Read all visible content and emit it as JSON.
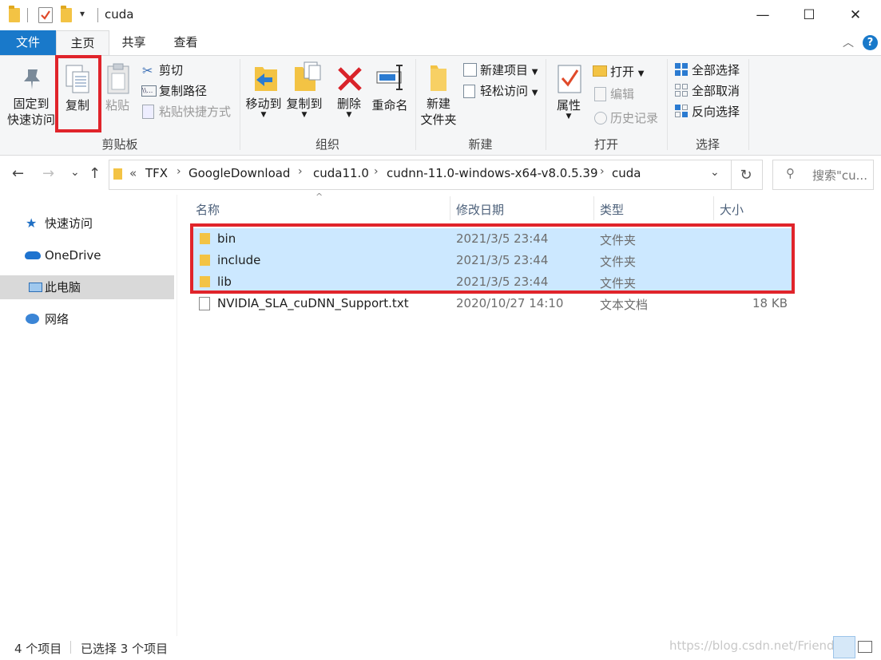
{
  "window": {
    "title": "cuda",
    "minimize_glyph": "—",
    "maximize_glyph": "☐",
    "close_glyph": "✕"
  },
  "quick_access_toolbar": {
    "dropdown_glyph": "▾"
  },
  "ribbon_tabs": [
    "文件",
    "主页",
    "共享",
    "查看"
  ],
  "ribbon": {
    "clipboard": {
      "label": "剪贴板",
      "pin_label_1": "固定到",
      "pin_label_2": "快速访问",
      "copy_label": "复制",
      "paste_label": "粘贴",
      "cut_label": "剪切",
      "copy_path_label": "复制路径",
      "paste_shortcut_label": "粘贴快捷方式"
    },
    "organize": {
      "label": "组织",
      "move_to_label": "移动到",
      "copy_to_label": "复制到",
      "delete_label": "删除",
      "rename_label": "重命名"
    },
    "new": {
      "label": "新建",
      "new_folder_label_1": "新建",
      "new_folder_label_2": "文件夹",
      "new_item_label": "新建项目",
      "easy_access_label": "轻松访问"
    },
    "open": {
      "label": "打开",
      "properties_label": "属性",
      "open_label": "打开",
      "edit_label": "编辑",
      "history_label": "历史记录"
    },
    "select": {
      "label": "选择",
      "select_all_label": "全部选择",
      "select_none_label": "全部取消",
      "invert_label": "反向选择"
    }
  },
  "address": {
    "overflow": "«",
    "crumbs": [
      "TFX",
      "GoogleDownload",
      "cuda11.0",
      "cudnn-11.0-windows-x64-v8.0.5.39",
      "cuda"
    ],
    "search_placeholder": "搜索\"cu...",
    "back_glyph": "←",
    "forward_glyph": "→",
    "recent_glyph": "⌄",
    "up_glyph": "↑",
    "refresh_glyph": "↻"
  },
  "nav_pane": {
    "items": [
      "快速访问",
      "OneDrive",
      "此电脑",
      "网络"
    ]
  },
  "file_list": {
    "columns": [
      "名称",
      "修改日期",
      "类型",
      "大小"
    ],
    "rows": [
      {
        "name": "bin",
        "date": "2021/3/5 23:44",
        "type": "文件夹",
        "size": ""
      },
      {
        "name": "include",
        "date": "2021/3/5 23:44",
        "type": "文件夹",
        "size": ""
      },
      {
        "name": "lib",
        "date": "2021/3/5 23:44",
        "type": "文件夹",
        "size": ""
      },
      {
        "name": "NVIDIA_SLA_cuDNN_Support.txt",
        "date": "2020/10/27 14:10",
        "type": "文本文档",
        "size": "18 KB"
      }
    ]
  },
  "status": {
    "item_count": "4 个项目",
    "selected_count": "已选择 3 个项目"
  },
  "watermark": "https://blog.csdn.net/Friendsm",
  "colors": {
    "accent": "#1979ca",
    "selection": "#cce8ff",
    "highlight_box": "#e0242b",
    "folder": "#f3c344"
  }
}
